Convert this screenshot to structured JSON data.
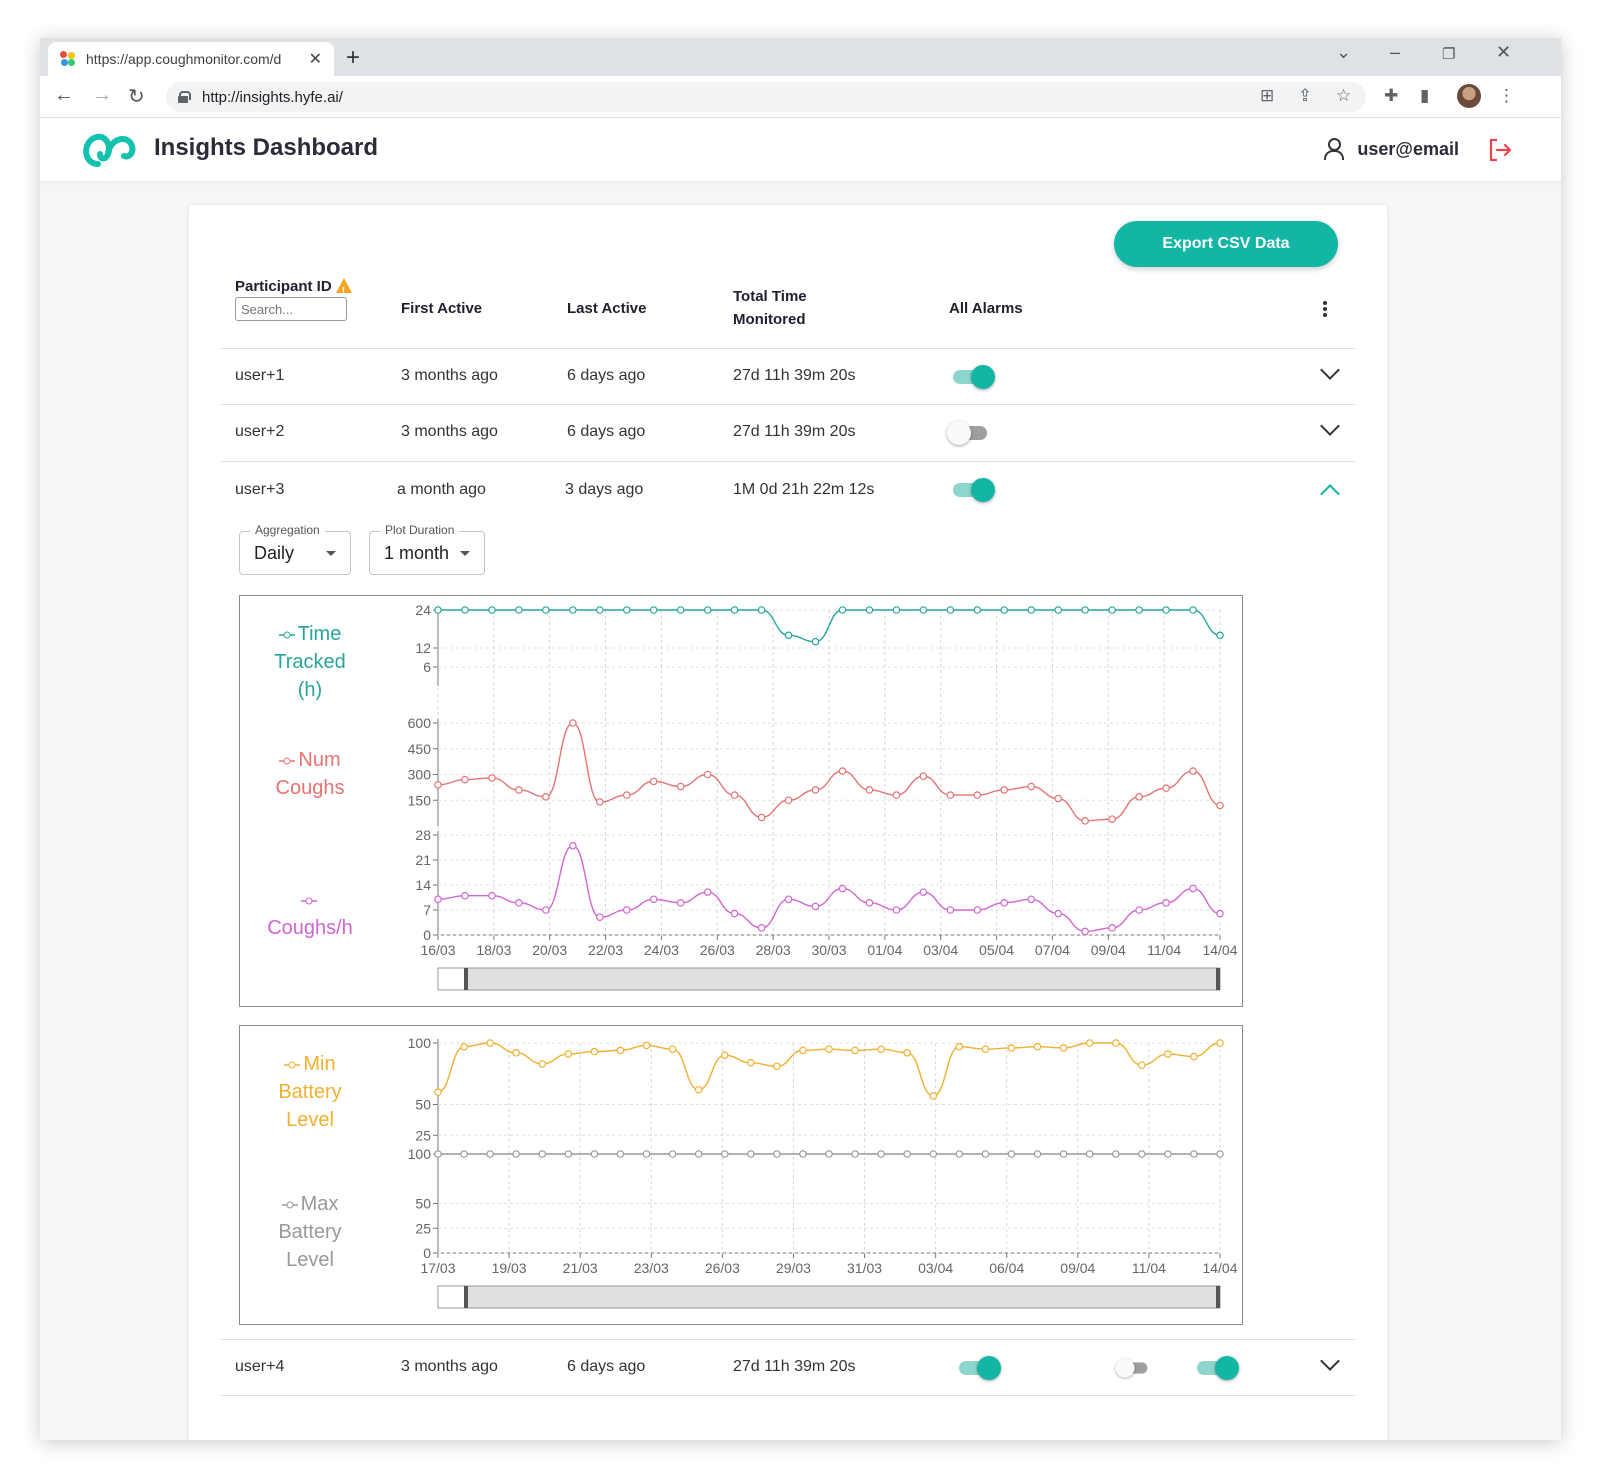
{
  "browser": {
    "tab_title": "https://app.coughmonitor.com/d",
    "url": "http://insights.hyfe.ai/"
  },
  "app": {
    "title": "Insights Dashboard",
    "user": "user@email",
    "accent_color": "#13b5a4",
    "logout_color": "#e8464d"
  },
  "toolbar": {
    "export_label": "Export CSV Data"
  },
  "table": {
    "headers": {
      "participant_id": "Participant ID",
      "first_active": "First Active",
      "last_active": "Last Active",
      "total_time_1": "Total Time",
      "total_time_2": "Monitored",
      "all_alarms": "All Alarms"
    },
    "search_placeholder": "Search...",
    "rows": [
      {
        "id": "user+1",
        "first": "3 months ago",
        "last": "6 days ago",
        "total": "27d 11h 39m 20s",
        "alarm": true
      },
      {
        "id": "user+2",
        "first": "3 months ago",
        "last": "6 days ago",
        "total": "27d 11h 39m 20s",
        "alarm": false
      },
      {
        "id": "user+3",
        "first": "a month ago",
        "last": "3 days ago",
        "total": "1M 0d 21h 22m 12s",
        "alarm": true
      },
      {
        "id": "user+4",
        "first": "3 months ago",
        "last": "6 days ago",
        "total": "27d 11h 39m 20s",
        "alarm": true
      }
    ]
  },
  "controls": {
    "aggregation_label": "Aggregation",
    "aggregation_value": "Daily",
    "duration_label": "Plot Duration",
    "duration_value": "1 month"
  },
  "chart_data": [
    {
      "type": "line",
      "panel": "activity",
      "x_ticks": [
        "16/03",
        "18/03",
        "20/03",
        "22/03",
        "24/03",
        "26/03",
        "28/03",
        "30/03",
        "01/04",
        "03/04",
        "05/04",
        "07/04",
        "09/04",
        "11/04",
        "14/04"
      ],
      "series": [
        {
          "name": "Time Tracked (h)",
          "color": "#26a69a",
          "yticks": [
            6,
            12,
            24
          ],
          "ylim": [
            0,
            24
          ],
          "values": [
            24,
            24,
            24,
            24,
            24,
            24,
            24,
            24,
            24,
            24,
            24,
            24,
            24,
            16,
            14,
            24,
            24,
            24,
            24,
            24,
            24,
            24,
            24,
            24,
            24,
            24,
            24,
            24,
            24,
            16
          ]
        },
        {
          "name": "Num Coughs",
          "color": "#e57373",
          "yticks": [
            150,
            300,
            450,
            600
          ],
          "ylim": [
            0,
            600
          ],
          "values": [
            240,
            270,
            280,
            210,
            170,
            600,
            140,
            180,
            260,
            230,
            300,
            180,
            50,
            150,
            210,
            320,
            210,
            180,
            290,
            180,
            180,
            210,
            230,
            160,
            30,
            40,
            170,
            220,
            320,
            120
          ]
        },
        {
          "name": "Coughs/h",
          "color": "#d066d0",
          "yticks": [
            0,
            7,
            14,
            21,
            28
          ],
          "ylim": [
            0,
            28
          ],
          "values": [
            10,
            11,
            11,
            9,
            7,
            25,
            5,
            7,
            10,
            9,
            12,
            6,
            2,
            10,
            8,
            13,
            9,
            7,
            12,
            7,
            7,
            9,
            10,
            6,
            1,
            2,
            7,
            9,
            13,
            6
          ]
        }
      ]
    },
    {
      "type": "line",
      "panel": "battery",
      "x_ticks": [
        "17/03",
        "19/03",
        "21/03",
        "23/03",
        "26/03",
        "29/03",
        "31/03",
        "03/04",
        "06/04",
        "09/04",
        "11/04",
        "14/04"
      ],
      "series": [
        {
          "name": "Min Battery Level",
          "color": "#f0b030",
          "yticks": [
            25,
            50,
            100
          ],
          "ylim": [
            0,
            100
          ],
          "values": [
            60,
            97,
            100,
            92,
            83,
            91,
            93,
            94,
            98,
            95,
            62,
            90,
            84,
            81,
            94,
            95,
            94,
            95,
            92,
            57,
            97,
            95,
            96,
            97,
            96,
            100,
            100,
            82,
            91,
            89,
            100
          ]
        },
        {
          "name": "Max Battery Level",
          "color": "#999999",
          "yticks": [
            0,
            25,
            50,
            100
          ],
          "ylim": [
            0,
            100
          ],
          "values": [
            100,
            100,
            100,
            100,
            100,
            100,
            100,
            100,
            100,
            100,
            100,
            100,
            100,
            100,
            100,
            100,
            100,
            100,
            100,
            100,
            100,
            100,
            100,
            100,
            100,
            100,
            100,
            100,
            100,
            100,
            100
          ]
        }
      ]
    }
  ]
}
